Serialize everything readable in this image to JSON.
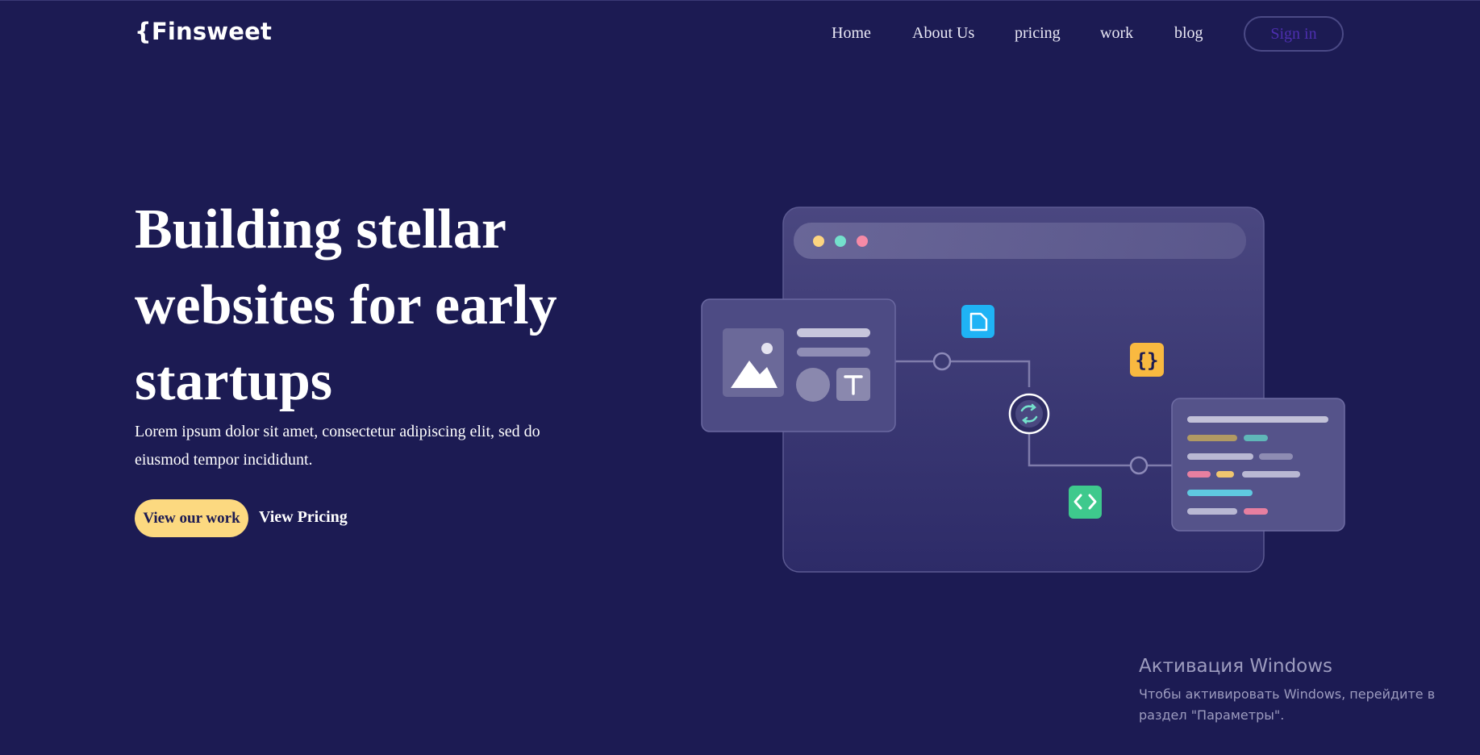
{
  "header": {
    "logo": "{Finsweet",
    "nav": [
      "Home",
      "About Us",
      "pricing",
      "work",
      "blog"
    ],
    "signin": "Sign in"
  },
  "hero": {
    "title": "Building stellar websites for early startups",
    "subtitle": "Lorem ipsum dolor sit amet, consectetur adipiscing elit, sed do eiusmod tempor incididunt.",
    "primary_button": "View our work",
    "secondary_button": "View Pricing"
  },
  "illustration": {
    "dot_colors": [
      "#fdd580",
      "#74e0cc",
      "#f58aa6"
    ],
    "icons": [
      "document-icon",
      "braces-icon",
      "sync-icon",
      "code-icon",
      "image-placeholder-icon",
      "text-tool-icon"
    ],
    "icon_colors": {
      "document": "#1fb3f5",
      "braces": "#f9b940",
      "code": "#3ec98d",
      "sync": "#74e0cc"
    }
  },
  "watermark": {
    "title": "Активация Windows",
    "text": "Чтобы активировать Windows, перейдите в раздел \"Параметры\"."
  },
  "colors": {
    "background": "#1c1b53",
    "accent": "#fcd980",
    "signin_text": "#4d2fb0"
  }
}
